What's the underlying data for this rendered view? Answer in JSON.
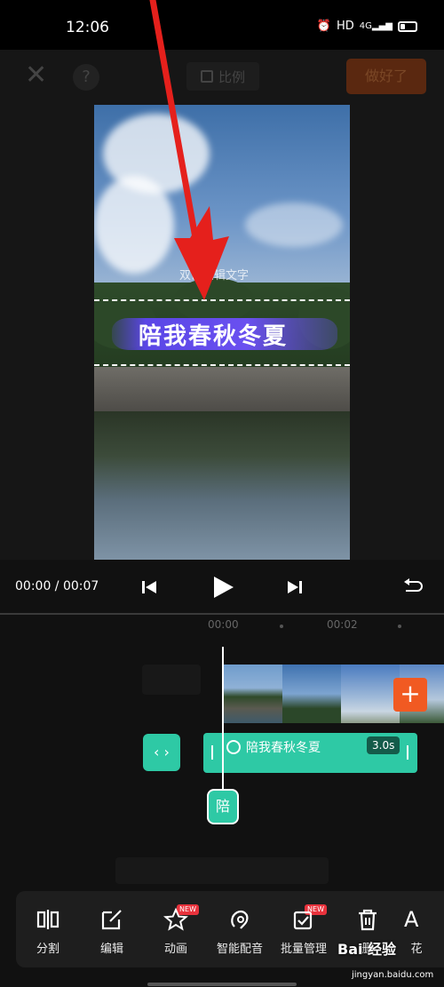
{
  "status": {
    "time": "12:06",
    "hd": "HD",
    "signal": "4G"
  },
  "topbar": {
    "ratio_label": "比例",
    "done_label": "做好了",
    "help_label": "?"
  },
  "preview": {
    "hint_text": "双击编辑文字",
    "caption_text": "陪我春秋冬夏"
  },
  "playback": {
    "timecode": "00:00 / 00:07"
  },
  "timeline": {
    "ruler": [
      "00:00",
      "00:02"
    ],
    "text_clip_label": "陪我春秋冬夏",
    "text_clip_duration": "3.0s",
    "cursor_char": "陪"
  },
  "tools": [
    {
      "label": "分割",
      "icon": "split-icon",
      "new": false
    },
    {
      "label": "编辑",
      "icon": "edit-icon",
      "new": false
    },
    {
      "label": "动画",
      "icon": "star-icon",
      "new": true
    },
    {
      "label": "智能配音",
      "icon": "voice-icon",
      "new": false
    },
    {
      "label": "批量管理",
      "icon": "batch-icon",
      "new": true
    },
    {
      "label": "删",
      "icon": "delete-icon",
      "new": false
    },
    {
      "label": "花",
      "icon": "fancy-text-icon",
      "new": false
    }
  ],
  "badges": {
    "new": "NEW"
  },
  "watermark": {
    "main": "Bai 经验",
    "sub": "jingyan.baidu.com"
  },
  "colors": {
    "accent_teal": "#2ec9a5",
    "accent_orange": "#f15a22",
    "arrow_red": "#e5201c"
  }
}
